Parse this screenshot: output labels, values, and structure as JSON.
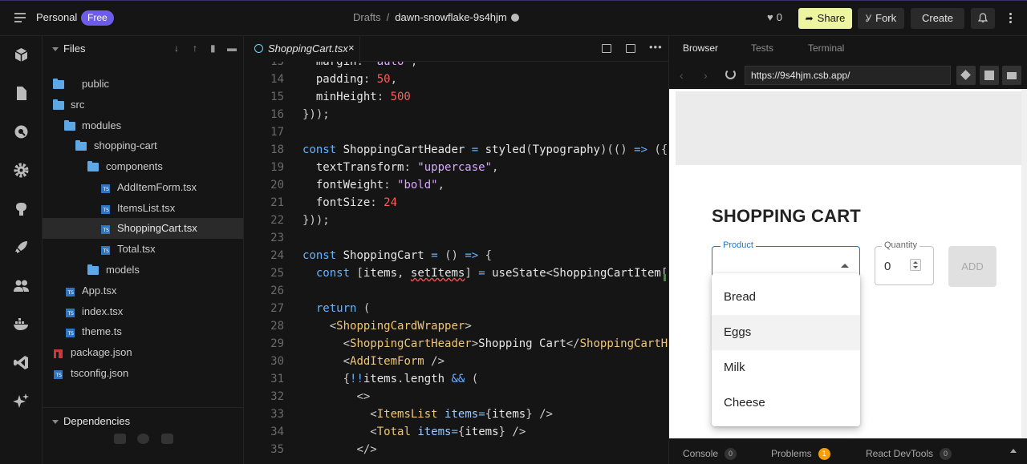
{
  "topbar": {
    "workspace": "Personal",
    "plan_badge": "Free",
    "crumb_folder": "Drafts",
    "crumb_separator": "/",
    "sandbox_name": "dawn-snowflake-9s4hjm",
    "likes": "0",
    "share_label": "Share",
    "fork_label": "Fork",
    "create_label": "Create"
  },
  "files": {
    "title": "Files",
    "tree": [
      {
        "label": "public",
        "type": "folder"
      },
      {
        "label": "src",
        "type": "folder"
      },
      {
        "label": "modules",
        "type": "folder"
      },
      {
        "label": "shopping-cart",
        "type": "folder"
      },
      {
        "label": "components",
        "type": "folder"
      },
      {
        "label": "AddItemForm.tsx",
        "type": "ts"
      },
      {
        "label": "ItemsList.tsx",
        "type": "ts"
      },
      {
        "label": "ShoppingCart.tsx",
        "type": "ts",
        "active": true
      },
      {
        "label": "Total.tsx",
        "type": "ts"
      },
      {
        "label": "models",
        "type": "folder"
      },
      {
        "label": "App.tsx",
        "type": "ts"
      },
      {
        "label": "index.tsx",
        "type": "ts"
      },
      {
        "label": "theme.ts",
        "type": "ts"
      },
      {
        "label": "package.json",
        "type": "npm"
      },
      {
        "label": "tsconfig.json",
        "type": "ts"
      }
    ],
    "dependencies_title": "Dependencies"
  },
  "editor": {
    "tab_label": "ShoppingCart.tsx",
    "tab_close": "×",
    "more": "•••",
    "lines": [
      {
        "n": "13",
        "text": "  margin: \"auto\","
      },
      {
        "n": "14",
        "text": "  padding: 50,"
      },
      {
        "n": "15",
        "text": "  minHeight: 500"
      },
      {
        "n": "16",
        "text": "}));"
      },
      {
        "n": "17",
        "text": ""
      },
      {
        "n": "18",
        "text": "const ShoppingCartHeader = styled(Typography)(() => ({"
      },
      {
        "n": "19",
        "text": "  textTransform: \"uppercase\","
      },
      {
        "n": "20",
        "text": "  fontWeight: \"bold\","
      },
      {
        "n": "21",
        "text": "  fontSize: 24"
      },
      {
        "n": "22",
        "text": "}));"
      },
      {
        "n": "23",
        "text": ""
      },
      {
        "n": "24",
        "text": "const ShoppingCart = () => {"
      },
      {
        "n": "25",
        "text": "  const [items, setItems] = useState<ShoppingCartItem[]>([]);"
      },
      {
        "n": "26",
        "text": ""
      },
      {
        "n": "27",
        "text": "  return ("
      },
      {
        "n": "28",
        "text": "    <ShoppingCardWrapper>"
      },
      {
        "n": "29",
        "text": "      <ShoppingCartHeader>Shopping Cart</ShoppingCartHeader>"
      },
      {
        "n": "30",
        "text": "      <AddItemForm />"
      },
      {
        "n": "31",
        "text": "      {!!items.length && ("
      },
      {
        "n": "32",
        "text": "        <>"
      },
      {
        "n": "33",
        "text": "          <ItemsList items={items} />"
      },
      {
        "n": "34",
        "text": "          <Total items={items} />"
      },
      {
        "n": "35",
        "text": "        </>"
      }
    ]
  },
  "preview": {
    "tabs": [
      "Browser",
      "Tests",
      "Terminal"
    ],
    "url": "https://9s4hjm.csb.app/",
    "app_title": "SHOPPING CART",
    "product_label": "Product",
    "quantity_label": "Quantity",
    "quantity_value": "0",
    "add_label": "ADD",
    "options": [
      "Bread",
      "Eggs",
      "Milk",
      "Cheese"
    ],
    "highlighted_option": "Eggs"
  },
  "bottombar": {
    "console_label": "Console",
    "console_count": "0",
    "problems_label": "Problems",
    "problems_count": "1",
    "devtools_label": "React DevTools",
    "devtools_count": "0"
  },
  "colors": {
    "accent": "#6c5ce7",
    "share_button": "#eef5a0",
    "folder": "#5fa8e6",
    "typescript": "#2f74c0",
    "field_focus": "#1976d2",
    "warning_badge": "#f59e0b"
  }
}
